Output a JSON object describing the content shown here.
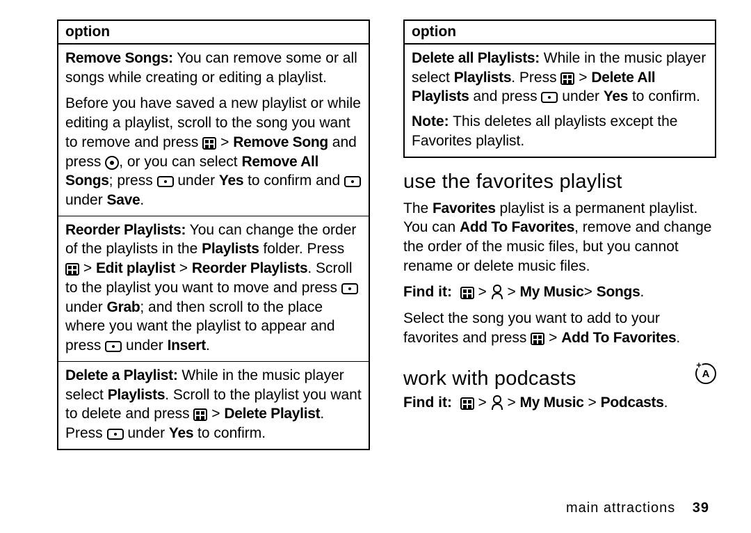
{
  "left": {
    "header": "option",
    "rows": [
      {
        "lead": "Remove Songs:",
        "text1": " You can remove some or all songs while creating or editing a playlist.",
        "para2_a": "Before you have saved a new playlist or while editing a playlist, scroll to the song you want to remove and press ",
        "menu_gt": " > ",
        "remove_song": "Remove Song",
        "para2_b": " and press ",
        "para2_c": ", or you can select ",
        "remove_all": "Remove All Songs",
        "para2_d": "; press ",
        "under_yes": " under ",
        "yes": "Yes",
        "para2_e": " to confirm and ",
        "under_save": " under ",
        "save": "Save",
        "period": "."
      },
      {
        "lead": "Reorder Playlists:",
        "a": " You can change the order of the playlists in the ",
        "playlists": "Playlists",
        "b": " folder. Press ",
        "gt": " > ",
        "edit": "Edit playlist",
        "gt2": " > ",
        "reorder": "Reorder Playlists",
        "c": ". Scroll to the playlist you want to move and press ",
        "under1": " under ",
        "grab": "Grab",
        "d": "; and then scroll to the place where you want the playlist to appear and press ",
        "under2": " under ",
        "insert": "Insert",
        "period": "."
      },
      {
        "lead": "Delete a Playlist:",
        "a": " While in the music player select ",
        "playlists": "Playlists",
        "b": ". Scroll to the playlist you want to delete and press ",
        "gt": " > ",
        "del": "Delete Playlist",
        "c": ". Press ",
        "under": " under ",
        "yes": "Yes",
        "d": " to confirm."
      }
    ]
  },
  "right": {
    "header": "option",
    "row": {
      "lead": "Delete all Playlists:",
      "a": " While in the music player select ",
      "playlists": "Playlists",
      "b": ". Press ",
      "gt": " > ",
      "delall": "Delete All Playlists",
      "c": " and press ",
      "under": " under ",
      "yes": "Yes",
      "d": " to confirm.",
      "note_lead": "Note:",
      "note": " This deletes all playlists except the Favorites playlist."
    },
    "h_fav": "use the favorites playlist",
    "fav_a": "The ",
    "fav_b": "Favorites",
    "fav_c": " playlist is a permanent playlist. You can ",
    "fav_add": "Add To Favorites",
    "fav_d": ", remove and change the order of the music files, but you cannot rename or delete music files.",
    "findit": "Find it:",
    "nav1_a": " > ",
    "nav1_b": " > ",
    "nav1_c": "My Music",
    "nav1_d": "> ",
    "nav1_e": "Songs",
    "nav1_period": ".",
    "sel_a": "Select the song you want to add to your favorites and press ",
    "sel_gt": " > ",
    "sel_add": "Add To Favorites",
    "sel_period": ".",
    "h_pod": "work with podcasts",
    "feature_label": "A",
    "nav2_a": " > ",
    "nav2_b": " > ",
    "nav2_c": "My Music",
    "nav2_d": " > ",
    "nav2_e": "Podcasts",
    "nav2_period": "."
  },
  "footer": {
    "section": "main attractions",
    "page": "39"
  }
}
